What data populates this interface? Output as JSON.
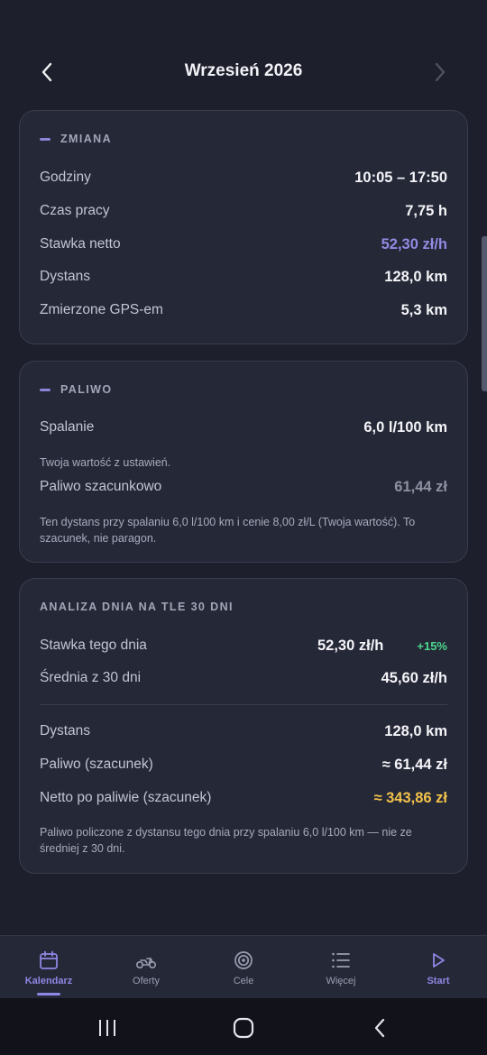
{
  "header": {
    "title": "Wrzesień 2026"
  },
  "shift": {
    "title": "ZMIANA",
    "rows": [
      {
        "label": "Godziny",
        "value": "10:05 – 17:50"
      },
      {
        "label": "Czas pracy",
        "value": "7,75 h"
      },
      {
        "label": "Stawka netto",
        "value": "52,30 zł/h"
      },
      {
        "label": "Dystans",
        "value": "128,0 km"
      },
      {
        "label": "Zmierzone GPS-em",
        "value": "5,3 km"
      }
    ]
  },
  "fuel": {
    "title": "PALIWO",
    "consumption_label": "Spalanie",
    "consumption_value": "6,0 l/100 km",
    "consumption_note": "Twoja wartość z ustawień.",
    "estimate_label": "Paliwo szacunkowo",
    "estimate_value": "61,44 zł",
    "estimate_note": "Ten dystans przy spalaniu 6,0 l/100 km i cenie 8,00 zł/L (Twoja wartość). To szacunek, nie paragon."
  },
  "analysis": {
    "title": "ANALIZA DNIA NA TLE 30 DNI",
    "rate_label": "Stawka tego dnia",
    "rate_value": "52,30 zł/h",
    "rate_change": "+15%",
    "avg_label": "Średnia z 30 dni",
    "avg_value": "45,60 zł/h",
    "distance_label": "Dystans",
    "distance_value": "128,0 km",
    "fuel_label": "Paliwo (szacunek)",
    "fuel_value": "≈ 61,44 zł",
    "net_label": "Netto po paliwie (szacunek)",
    "net_value": "≈ 343,86 zł",
    "note": "Paliwo policzone z dystansu tego dnia przy spalaniu 6,0 l/100 km — nie ze średniej z 30 dni."
  },
  "tabs": [
    {
      "label": "Kalendarz",
      "icon": "calendar-icon",
      "active": true
    },
    {
      "label": "Oferty",
      "icon": "scooter-icon",
      "active": false
    },
    {
      "label": "Cele",
      "icon": "target-icon",
      "active": false
    },
    {
      "label": "Więcej",
      "icon": "list-icon",
      "active": false
    },
    {
      "label": "Start",
      "icon": "play-icon",
      "active": true
    }
  ],
  "colors": {
    "background": "#1d1f2c",
    "card": "#252837",
    "accent": "#8f87e5",
    "positive": "#4cd88c",
    "highlight": "#f2c24a"
  }
}
